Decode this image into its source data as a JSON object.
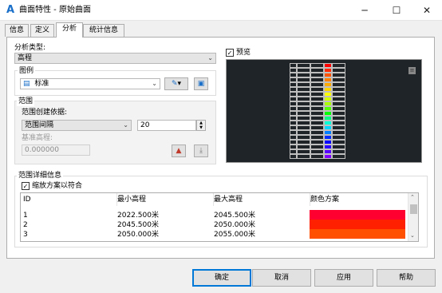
{
  "window": {
    "title": "曲面特性 - 原始曲面"
  },
  "tabs": [
    {
      "label": "信息"
    },
    {
      "label": "定义"
    },
    {
      "label": "分析"
    },
    {
      "label": "统计信息"
    }
  ],
  "analysis": {
    "type_label": "分析类型:",
    "type_value": "高程"
  },
  "legend": {
    "group_label": "图例",
    "value": "标准"
  },
  "range": {
    "group_label": "范围",
    "create_by_label": "范围创建依据:",
    "create_by_value": "范围间隔",
    "interval_value": "20",
    "base_elevation_label": "基准高程:",
    "base_elevation_value": "0.000000"
  },
  "preview": {
    "checkbox_label": "预览",
    "checked": true,
    "legend_colors": [
      "#ff0000",
      "#ff2a00",
      "#ff5500",
      "#ff8000",
      "#ffaa00",
      "#ffd500",
      "#ffff00",
      "#d4ff00",
      "#aaff00",
      "#55ff00",
      "#00ff00",
      "#00ff80",
      "#00ffd5",
      "#00d5ff",
      "#0080ff",
      "#002aff",
      "#0000ff",
      "#2a00ff",
      "#5500ff",
      "#8000ff"
    ]
  },
  "details": {
    "group_label": "范围详细信息",
    "scale_checkbox_label": "缩放方案以符合",
    "scale_checked": true,
    "columns": [
      "ID",
      "最小高程",
      "最大高程",
      "颜色方案"
    ],
    "rows": [
      {
        "id": "1",
        "min": "2022.500米",
        "max": "2045.500米",
        "color": "#ff0030"
      },
      {
        "id": "2",
        "min": "2045.500米",
        "max": "2050.000米",
        "color": "#ff2000"
      },
      {
        "id": "3",
        "min": "2050.000米",
        "max": "2055.000米",
        "color": "#ff5000"
      }
    ]
  },
  "buttons": {
    "ok": "确定",
    "cancel": "取消",
    "apply": "应用",
    "help": "帮助"
  }
}
